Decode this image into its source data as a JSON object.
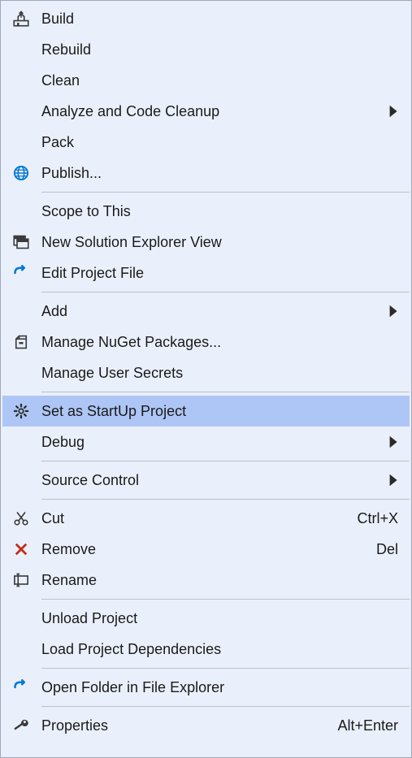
{
  "menu": {
    "items": [
      {
        "label": "Build",
        "icon": "build-icon",
        "submenu": false,
        "shortcut": ""
      },
      {
        "label": "Rebuild",
        "icon": "",
        "submenu": false,
        "shortcut": ""
      },
      {
        "label": "Clean",
        "icon": "",
        "submenu": false,
        "shortcut": ""
      },
      {
        "label": "Analyze and Code Cleanup",
        "icon": "",
        "submenu": true,
        "shortcut": ""
      },
      {
        "label": "Pack",
        "icon": "",
        "submenu": false,
        "shortcut": ""
      },
      {
        "label": "Publish...",
        "icon": "publish-icon",
        "submenu": false,
        "shortcut": ""
      },
      {
        "separator": true
      },
      {
        "label": "Scope to This",
        "icon": "",
        "submenu": false,
        "shortcut": ""
      },
      {
        "label": "New Solution Explorer View",
        "icon": "new-view-icon",
        "submenu": false,
        "shortcut": ""
      },
      {
        "label": "Edit Project File",
        "icon": "edit-arrow-icon",
        "submenu": false,
        "shortcut": ""
      },
      {
        "separator": true
      },
      {
        "label": "Add",
        "icon": "",
        "submenu": true,
        "shortcut": ""
      },
      {
        "label": "Manage NuGet Packages...",
        "icon": "nuget-icon",
        "submenu": false,
        "shortcut": ""
      },
      {
        "label": "Manage User Secrets",
        "icon": "",
        "submenu": false,
        "shortcut": ""
      },
      {
        "separator": true
      },
      {
        "label": "Set as StartUp Project",
        "icon": "gear-icon",
        "submenu": false,
        "shortcut": "",
        "highlighted": true
      },
      {
        "label": "Debug",
        "icon": "",
        "submenu": true,
        "shortcut": ""
      },
      {
        "separator": true
      },
      {
        "label": "Source Control",
        "icon": "",
        "submenu": true,
        "shortcut": ""
      },
      {
        "separator": true
      },
      {
        "label": "Cut",
        "icon": "cut-icon",
        "submenu": false,
        "shortcut": "Ctrl+X"
      },
      {
        "label": "Remove",
        "icon": "remove-icon",
        "submenu": false,
        "shortcut": "Del"
      },
      {
        "label": "Rename",
        "icon": "rename-icon",
        "submenu": false,
        "shortcut": ""
      },
      {
        "separator": true
      },
      {
        "label": "Unload Project",
        "icon": "",
        "submenu": false,
        "shortcut": ""
      },
      {
        "label": "Load Project Dependencies",
        "icon": "",
        "submenu": false,
        "shortcut": ""
      },
      {
        "separator": true
      },
      {
        "label": "Open Folder in File Explorer",
        "icon": "open-arrow-icon",
        "submenu": false,
        "shortcut": ""
      },
      {
        "separator": true
      },
      {
        "label": "Properties",
        "icon": "wrench-icon",
        "submenu": false,
        "shortcut": "Alt+Enter"
      }
    ]
  }
}
